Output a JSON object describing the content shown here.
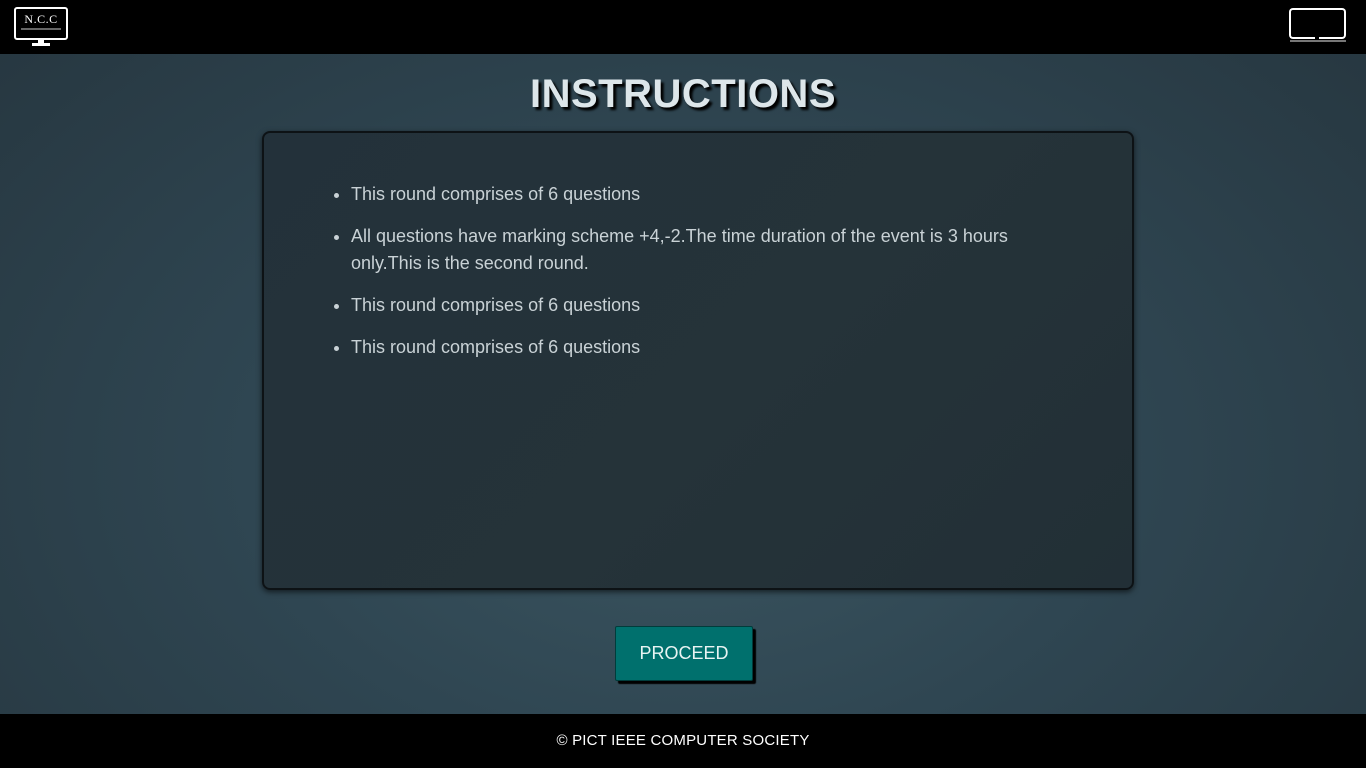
{
  "header": {
    "left_logo_text": "N.C.C",
    "right_logo_name": "credenz-logo"
  },
  "page": {
    "title": "INSTRUCTIONS"
  },
  "instructions": {
    "items": [
      "This round comprises of 6 questions",
      "All questions have marking scheme +4,-2.The time duration of the event is 3 hours only.This is the second round.",
      "This round comprises of 6 questions",
      "This round comprises of 6 questions"
    ]
  },
  "actions": {
    "proceed_label": "PROCEED"
  },
  "footer": {
    "copyright": "© PICT IEEE COMPUTER SOCIETY"
  },
  "colors": {
    "bar_background": "#000000",
    "panel_background": "#243238",
    "button_background": "#00706d",
    "title_text": "#dde6ea"
  }
}
